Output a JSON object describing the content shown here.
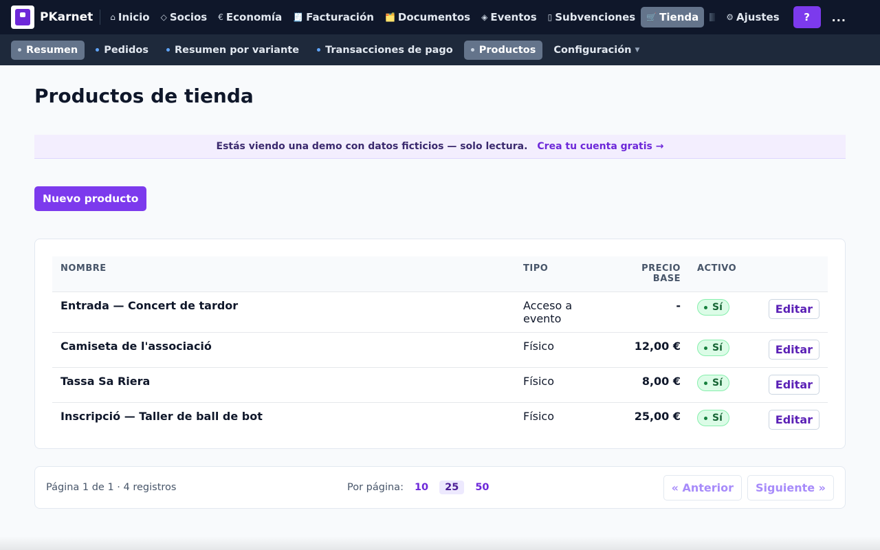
{
  "topnav": {
    "brand": "PKarnet",
    "items": [
      {
        "icon": "⌂",
        "label": "Inicio"
      },
      {
        "icon": "◇",
        "label": "Socios"
      },
      {
        "icon": "€",
        "label": "Economía"
      },
      {
        "icon": "🧾",
        "label": "Facturación"
      },
      {
        "icon": "🗂️",
        "label": "Documentos"
      },
      {
        "icon": "◈",
        "label": "Eventos"
      },
      {
        "icon": "▯",
        "label": "Subvenciones"
      },
      {
        "icon": "🛒",
        "label": "Tienda"
      },
      {
        "icon": "⚙",
        "label": "Ajustes"
      }
    ],
    "help_label": "?",
    "more_label": "..."
  },
  "subnav": {
    "items": [
      {
        "label": "Resumen"
      },
      {
        "label": "Pedidos"
      },
      {
        "label": "Resumen por variante"
      },
      {
        "label": "Transacciones de pago"
      },
      {
        "label": "Productos"
      },
      {
        "label": "Configuración"
      }
    ]
  },
  "page": {
    "title": "Productos de tienda",
    "demo_text": "Estás viendo una demo con datos ficticios — solo lectura.",
    "demo_link": "Crea tu cuenta gratis →",
    "new_button": "Nuevo producto"
  },
  "table": {
    "headers": {
      "name": "NOMBRE",
      "type": "TIPO",
      "price_line1": "PRECIO",
      "price_line2": "BASE",
      "active": "ACTIVO"
    },
    "edit_label": "Editar",
    "rows": [
      {
        "name": "Entrada — Concert de tardor",
        "type": "Acceso a evento",
        "price": "-",
        "active": "Sí"
      },
      {
        "name": "Camiseta de l'associació",
        "type": "Físico",
        "price": "12,00 €",
        "active": "Sí"
      },
      {
        "name": "Tassa Sa Riera",
        "type": "Físico",
        "price": "8,00 €",
        "active": "Sí"
      },
      {
        "name": "Inscripció — Taller de ball de bot",
        "type": "Físico",
        "price": "25,00 €",
        "active": "Sí"
      }
    ]
  },
  "pager": {
    "summary": "Página 1 de 1 · 4 registros",
    "per_page_label": "Por página:",
    "options": [
      "10",
      "25",
      "50"
    ],
    "prev": "« Anterior",
    "next": "Siguiente »"
  },
  "colors": {
    "accent": "#7c3aed",
    "nav_bg": "#0f172a",
    "subnav_bg": "#1e293b",
    "active_badge": "#dcfce7"
  }
}
